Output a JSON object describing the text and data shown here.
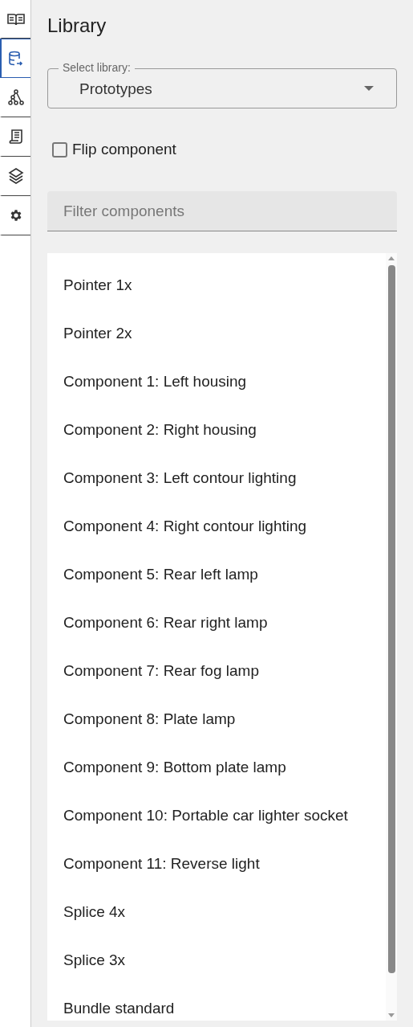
{
  "sidebar": {
    "items": [
      {
        "kind": "book",
        "selected": false
      },
      {
        "kind": "database",
        "selected": true
      },
      {
        "kind": "tree",
        "selected": false
      },
      {
        "kind": "script",
        "selected": false
      },
      {
        "kind": "layers",
        "selected": false
      },
      {
        "kind": "gear",
        "selected": false
      }
    ]
  },
  "title": "Library",
  "library_select": {
    "label": "Select library:",
    "value": "Prototypes"
  },
  "flip_component": {
    "label": "Flip component",
    "checked": false
  },
  "filter": {
    "placeholder": "Filter components"
  },
  "components": [
    "Pointer 1x",
    "Pointer 2x",
    "Component 1: Left housing",
    "Component 2: Right housing",
    "Component 3: Left contour lighting",
    "Component 4: Right contour lighting",
    "Component 5: Rear left lamp",
    "Component 6: Rear right lamp",
    "Component 7: Rear fog lamp",
    "Component 8: Plate lamp",
    "Component 9: Bottom plate lamp",
    "Component 10: Portable car lighter socket",
    "Component 11: Reverse light",
    "Splice 4x",
    "Splice 3x",
    "Bundle standard"
  ]
}
